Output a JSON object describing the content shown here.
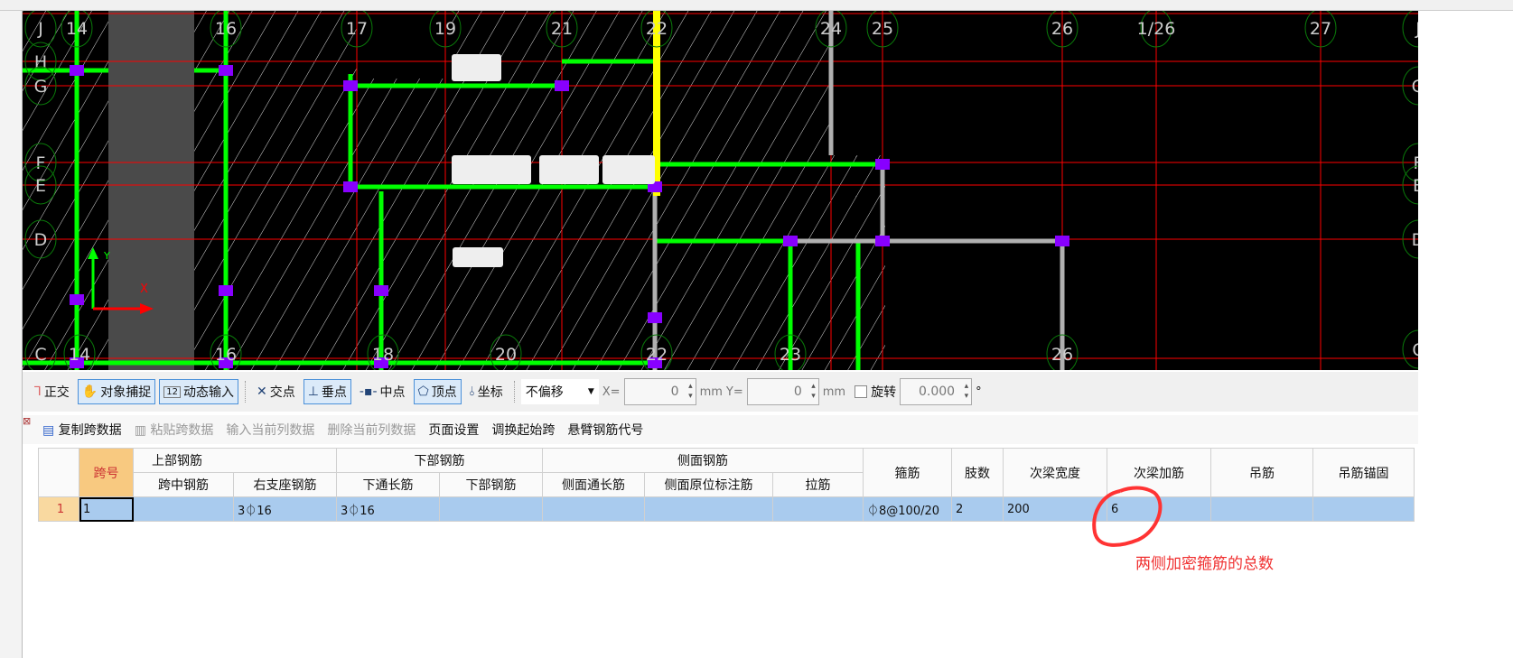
{
  "cad": {
    "top_axes": [
      "J",
      "14",
      "16",
      "17",
      "19",
      "21",
      "22",
      "24",
      "25",
      "26",
      "1/26",
      "27"
    ],
    "left_axes": [
      "H",
      "G",
      "F",
      "E",
      "D"
    ],
    "right_axes": [
      "J",
      "G",
      "F",
      "E",
      "D",
      "C"
    ],
    "bottom_axes": [
      "C",
      "14",
      "16",
      "18",
      "20",
      "22",
      "23",
      "26"
    ],
    "ucs_labels": {
      "x": "X",
      "y": "Y"
    },
    "colors": {
      "background": "#000000",
      "grid": "#ff0000",
      "beam": "#00ff00",
      "support": "#8800ff",
      "wall": "#b0b0b0",
      "selected": "#ffff00",
      "axis_circle": "#0a7a0a"
    }
  },
  "snapbar": {
    "ortho": "正交",
    "object_snap": "对象捕捉",
    "dynamic_input": "动态输入",
    "intersection": "交点",
    "perpendicular": "垂点",
    "midpoint": "中点",
    "vertex": "顶点",
    "coordinate": "坐标",
    "offset_mode": "不偏移",
    "x_label": "X=",
    "x_value": "0",
    "unit1": "mm",
    "y_label": "Y=",
    "y_value": "0",
    "unit2": "mm",
    "rotate_label": "旋转",
    "rotate_value": "0.000",
    "degree": "°"
  },
  "databar": {
    "copy": "复制跨数据",
    "paste": "粘贴跨数据",
    "input_col": "输入当前列数据",
    "delete_col": "删除当前列数据",
    "page_setup": "页面设置",
    "swap_start": "调换起始跨",
    "cantilever": "悬臂钢筋代号"
  },
  "table": {
    "span_no": "跨号",
    "groups": {
      "top": "上部钢筋",
      "bottom": "下部钢筋",
      "side": "侧面钢筋"
    },
    "headers": {
      "mid_span": "跨中钢筋",
      "right_support": "右支座钢筋",
      "bottom_through": "下通长筋",
      "bottom_bar": "下部钢筋",
      "side_through": "侧面通长筋",
      "side_in_situ": "侧面原位标注筋",
      "tie": "拉筋",
      "stirrup": "箍筋",
      "legs": "肢数",
      "sec_beam_width": "次梁宽度",
      "sec_beam_add": "次梁加筋",
      "hanger": "吊筋",
      "hanger_anchor": "吊筋锚固"
    },
    "rows": [
      {
        "row": "1",
        "span": "1",
        "mid_span": "",
        "right_support": "3⏀16",
        "bottom_through": "3⏀16",
        "bottom_bar": "",
        "side_through": "",
        "side_in_situ": "",
        "tie": "",
        "stirrup": "⏀8@100/20",
        "legs": "2",
        "sec_beam_width": "200",
        "sec_beam_add": "6",
        "hanger": "",
        "hanger_anchor": ""
      }
    ]
  },
  "annotation": {
    "text": "两侧加密箍筋的总数",
    "color": "#f03030"
  }
}
